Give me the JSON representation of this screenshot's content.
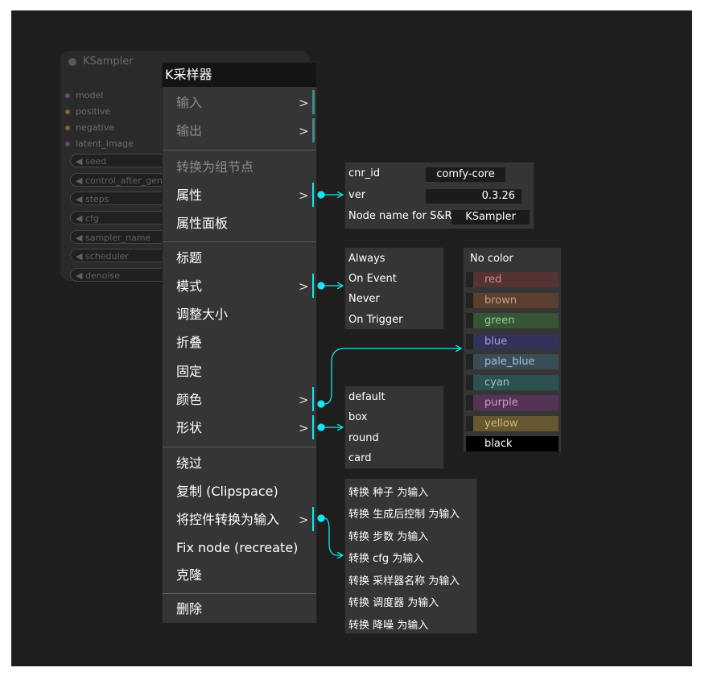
{
  "node": {
    "title": "KSampler",
    "inputs": [
      {
        "label": "model",
        "color": "#a86fb0"
      },
      {
        "label": "positive",
        "color": "#d99a3a"
      },
      {
        "label": "negative",
        "color": "#d99a3a"
      },
      {
        "label": "latent_image",
        "color": "#b65fc4"
      }
    ],
    "widgets": [
      "seed",
      "control_after_gen",
      "steps",
      "cfg",
      "sampler_name",
      "scheduler",
      "denoise"
    ]
  },
  "menu": {
    "title": "K采样器",
    "items": [
      {
        "label": "输入",
        "arrow": ">"
      },
      {
        "label": "输出",
        "arrow": ">"
      },
      {
        "label": "转换为组节点"
      },
      {
        "label": "属性",
        "arrow": ">"
      },
      {
        "label": "属性面板"
      },
      {
        "label": "标题"
      },
      {
        "label": "模式",
        "arrow": ">"
      },
      {
        "label": "调整大小"
      },
      {
        "label": "折叠"
      },
      {
        "label": "固定"
      },
      {
        "label": "颜色",
        "arrow": ">"
      },
      {
        "label": "形状",
        "arrow": ">"
      },
      {
        "label": "绕过"
      },
      {
        "label": "复制 (Clipspace)"
      },
      {
        "label": "将控件转换为输入",
        "arrow": ">"
      },
      {
        "label": "Fix node (recreate)"
      },
      {
        "label": "克隆"
      },
      {
        "label": "删除"
      }
    ]
  },
  "properties": [
    {
      "key": "cnr_id",
      "value": "comfy-core"
    },
    {
      "key": "ver",
      "value": "0.3.26"
    },
    {
      "key": "Node name for S&R",
      "value": "KSampler"
    }
  ],
  "modes": [
    "Always",
    "On Event",
    "Never",
    "On Trigger"
  ],
  "colors": {
    "header": "No color",
    "items": [
      {
        "label": "red",
        "bg": "#553333",
        "fg": "#cc8d8d"
      },
      {
        "label": "brown",
        "bg": "#5a3f2f",
        "fg": "#c8a088"
      },
      {
        "label": "green",
        "bg": "#355535",
        "fg": "#8fcf8f"
      },
      {
        "label": "blue",
        "bg": "#32325a",
        "fg": "#a5a5e0"
      },
      {
        "label": "pale_blue",
        "bg": "#3a4d57",
        "fg": "#9fc3d0"
      },
      {
        "label": "cyan",
        "bg": "#2f5050",
        "fg": "#8fc8c8"
      },
      {
        "label": "purple",
        "bg": "#553355",
        "fg": "#c89ac8"
      },
      {
        "label": "yellow",
        "bg": "#65572f",
        "fg": "#cfb97a"
      },
      {
        "label": "black",
        "bg": "#000000",
        "fg": "#ffffff"
      }
    ]
  },
  "shapes": [
    "default",
    "box",
    "round",
    "card"
  ],
  "convert_widgets": [
    "转换 种子 为输入",
    "转换 生成后控制 为输入",
    "转换 步数 为输入",
    "转换 cfg 为输入",
    "转换 采样器名称 为输入",
    "转换 调度器 为输入",
    "转换 降噪 为输入"
  ],
  "accent_color": "#12e6f0"
}
